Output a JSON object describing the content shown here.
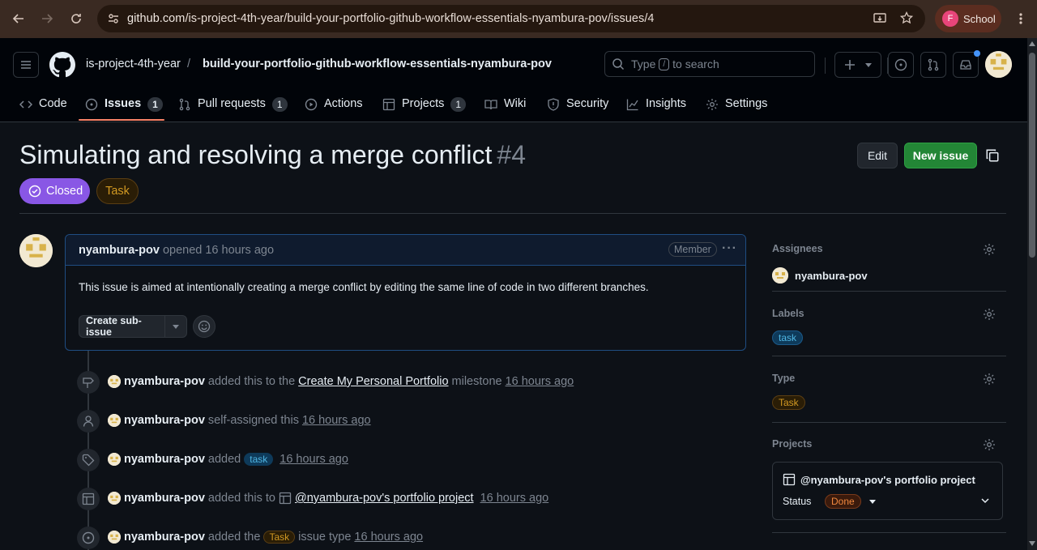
{
  "browser": {
    "url_host": "github.com",
    "url_path": "/is-project-4th-year/build-your-portfolio-github-workflow-essentials-nyambura-pov/issues/4",
    "profile_initial": "F",
    "profile_label": "School"
  },
  "header": {
    "owner": "is-project-4th-year",
    "separator": "/",
    "repo": "build-your-portfolio-github-workflow-essentials-nyambura-pov",
    "search_prefix": "Type",
    "search_key": "/",
    "search_suffix": "to search"
  },
  "tabs": [
    {
      "label": "Code",
      "icon": "code-icon"
    },
    {
      "label": "Issues",
      "count": "1",
      "icon": "issue-icon",
      "active": true
    },
    {
      "label": "Pull requests",
      "count": "1",
      "icon": "pull-request-icon"
    },
    {
      "label": "Actions",
      "icon": "play-icon"
    },
    {
      "label": "Projects",
      "count": "1",
      "icon": "table-icon"
    },
    {
      "label": "Wiki",
      "icon": "book-icon"
    },
    {
      "label": "Security",
      "icon": "shield-icon"
    },
    {
      "label": "Insights",
      "icon": "graph-icon"
    },
    {
      "label": "Settings",
      "icon": "gear-icon"
    }
  ],
  "issue": {
    "title": "Simulating and resolving a merge conflict",
    "number": "#4",
    "state": "Closed",
    "type": "Task",
    "edit_label": "Edit",
    "new_issue_label": "New issue"
  },
  "comment": {
    "author": "nyambura-pov",
    "meta": "opened 16 hours ago",
    "role": "Member",
    "more": "···",
    "body": "This issue is aimed at intentionally creating a merge conflict by editing the same line of code in two different branches.",
    "sub_issue_label": "Create sub-issue"
  },
  "timeline": [
    {
      "icon": "milestone-icon",
      "user": "nyambura-pov",
      "pre": "added this to the",
      "link": "Create My Personal Portfolio",
      "post": "milestone",
      "time": "16 hours ago"
    },
    {
      "icon": "person-icon",
      "user": "nyambura-pov",
      "pre": "self-assigned this",
      "time": "16 hours ago"
    },
    {
      "icon": "tag-icon",
      "user": "nyambura-pov",
      "pre": "added",
      "label": "task",
      "time": "16 hours ago"
    },
    {
      "icon": "table-icon",
      "user": "nyambura-pov",
      "pre": "added this to",
      "link": "@nyambura-pov's portfolio project",
      "time": "16 hours ago"
    },
    {
      "icon": "issue-icon",
      "user": "nyambura-pov",
      "pre": "added the",
      "label": "Task",
      "post": "issue type",
      "time": "16 hours ago"
    }
  ],
  "sidebar": {
    "assignees_title": "Assignees",
    "assignee": "nyambura-pov",
    "labels_title": "Labels",
    "label": "task",
    "type_title": "Type",
    "type": "Task",
    "projects_title": "Projects",
    "project_name": "@nyambura-pov's portfolio project",
    "status_label": "Status",
    "status_value": "Done"
  },
  "colors": {
    "accent_closed": "#8957e5",
    "new_issue_green": "#238636",
    "tab_underline": "#f78166"
  }
}
